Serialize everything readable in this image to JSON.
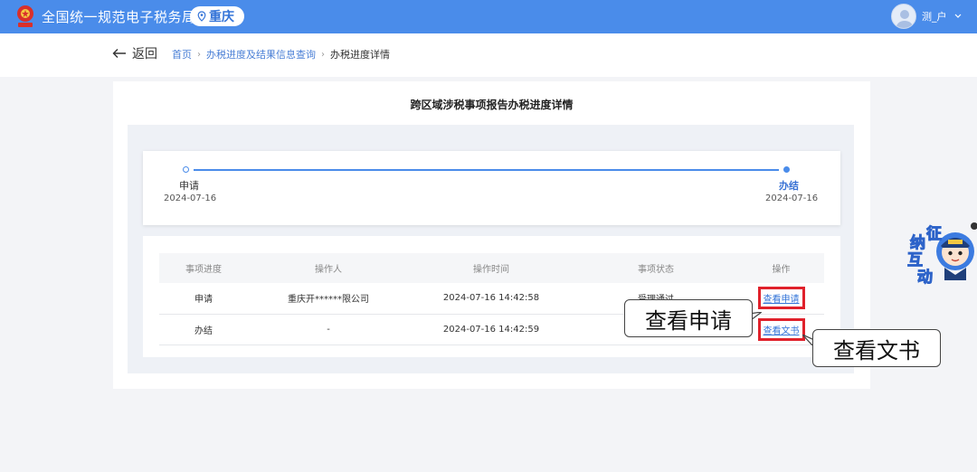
{
  "header": {
    "site_title": "全国统一规范电子税务局",
    "region": "重庆",
    "user_name": "测_户",
    "brand_color": "#4a8cea"
  },
  "nav": {
    "back_label": "返回",
    "breadcrumbs": [
      "首页",
      "办税进度及结果信息查询"
    ],
    "current": "办税进度详情"
  },
  "card": {
    "title": "跨区域涉税事项报告办税进度详情"
  },
  "progress": {
    "start_label": "申请",
    "start_date": "2024-07-16",
    "end_label": "办结",
    "end_date": "2024-07-16",
    "completion": 1.0
  },
  "table": {
    "headers": [
      "事项进度",
      "操作人",
      "操作时间",
      "事项状态",
      "操作"
    ],
    "rows": [
      {
        "stage": "申请",
        "operator": "重庆开******限公司",
        "time": "2024-07-16 14:42:58",
        "status": "受理通过",
        "action": "查看申请"
      },
      {
        "stage": "办结",
        "operator": "-",
        "time": "2024-07-16 14:42:59",
        "status": "",
        "action": "查看文书"
      }
    ]
  },
  "callouts": {
    "view_application": "查看申请",
    "view_document": "查看文书"
  },
  "assistant": {
    "chars": [
      "征",
      "纳",
      "互",
      "动"
    ]
  }
}
